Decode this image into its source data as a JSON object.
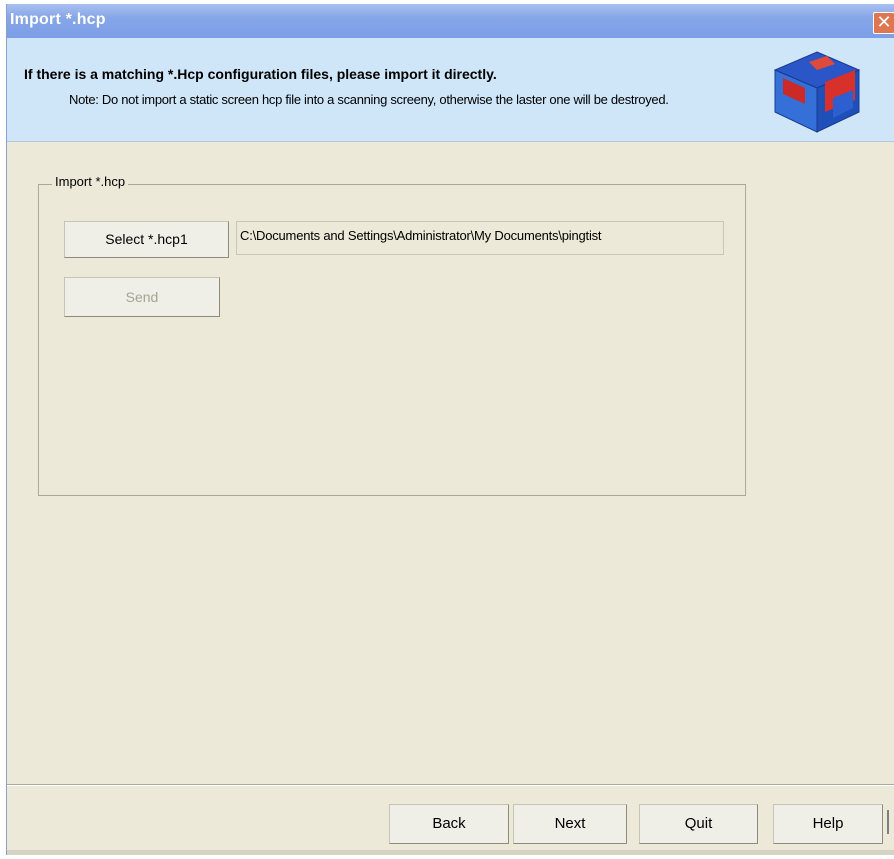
{
  "window": {
    "title": "Import *.hcp",
    "close_label": "✕"
  },
  "header": {
    "title": "If there is a matching *.Hcp configuration files, please import it directly.",
    "note": "Note: Do not import a static screen hcp file into a scanning screeny, otherwise the laster one will be destroyed."
  },
  "group": {
    "legend": "Import *.hcp",
    "select_label": "Select *.hcp1",
    "path_value": "C:\\Documents and Settings\\Administrator\\My Documents\\pingtist",
    "send_label": "Send"
  },
  "nav": {
    "back_label": "Back",
    "next_label": "Next",
    "quit_label": "Quit",
    "help_label": "Help"
  },
  "icons": {
    "wizard_cube": "cube-icon",
    "close": "close-icon"
  },
  "colors": {
    "title_bar": "#86a6e8",
    "header_panel": "#cfe6f8",
    "dialog_bg": "#ece9d8",
    "close_button": "#e0764f"
  }
}
